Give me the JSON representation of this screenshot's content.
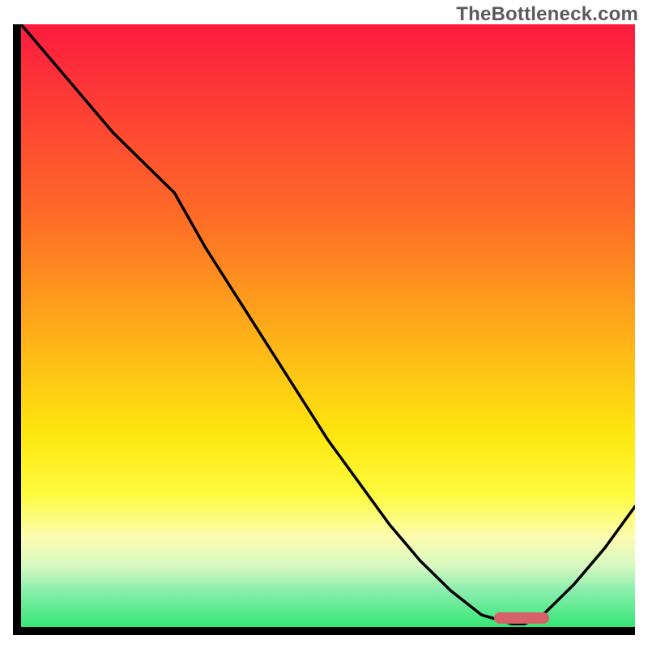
{
  "watermark": "TheBottleneck.com",
  "chart_data": {
    "type": "line",
    "title": "",
    "xlabel": "",
    "ylabel": "",
    "x": [
      0.0,
      0.05,
      0.1,
      0.15,
      0.2,
      0.25,
      0.3,
      0.35,
      0.4,
      0.45,
      0.5,
      0.55,
      0.6,
      0.65,
      0.7,
      0.75,
      0.8,
      0.82,
      0.85,
      0.9,
      0.95,
      1.0
    ],
    "values": [
      1.0,
      0.94,
      0.88,
      0.82,
      0.77,
      0.72,
      0.63,
      0.55,
      0.47,
      0.39,
      0.31,
      0.24,
      0.17,
      0.11,
      0.06,
      0.02,
      0.005,
      0.005,
      0.02,
      0.07,
      0.13,
      0.2
    ],
    "xlim": [
      0,
      1
    ],
    "ylim": [
      0,
      1
    ],
    "optimal_range_x": [
      0.77,
      0.86
    ],
    "series": [
      {
        "name": "bottleneck-curve",
        "x_key": "x",
        "y_key": "values",
        "color": "#000000"
      }
    ],
    "gradient_stops": [
      {
        "pos": 0.0,
        "color": "#fb1b3e"
      },
      {
        "pos": 0.32,
        "color": "#fe6c27"
      },
      {
        "pos": 0.68,
        "color": "#fee70f"
      },
      {
        "pos": 0.9,
        "color": "#d5f8c0"
      },
      {
        "pos": 1.0,
        "color": "#35e673"
      }
    ]
  }
}
